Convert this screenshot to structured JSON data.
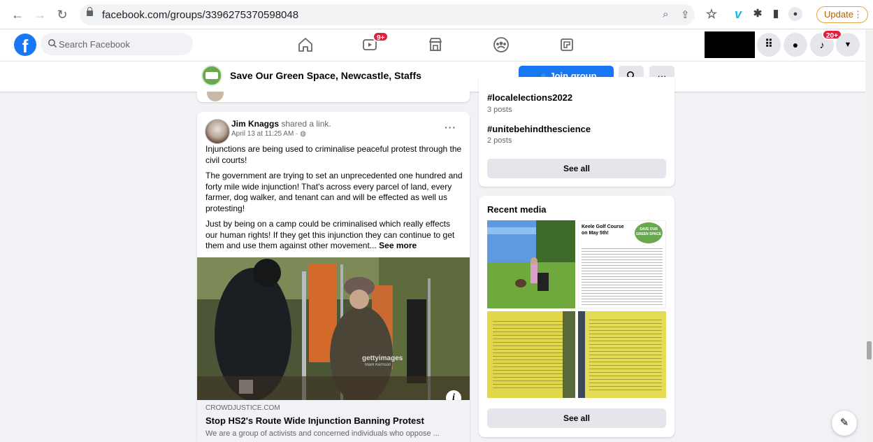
{
  "browser": {
    "url": "facebook.com/groups/3396275370598048",
    "update_label": "Update",
    "update_menu": "⋮"
  },
  "fb": {
    "search_placeholder": "Search Facebook",
    "watch_badge": "9+",
    "notif_badge": "20+"
  },
  "group": {
    "name": "Save Our Green Space, Newcastle, Staffs",
    "join_label": "Join group",
    "more_label": "···"
  },
  "post": {
    "author": "Jim Knaggs",
    "action": "shared a link.",
    "date": "April 13 at 11:25 AM · ",
    "more": "···",
    "paragraphs": [
      "Injunctions are being used to criminalise peaceful protest through the civil courts!",
      "The government are trying to set an unprecedented one hundred and forty mile wide injunction! That's across every parcel of land, every farmer, dog walker, and tenant can and will be effected as well us protesting!",
      "Just by being on a camp could be criminalised which really effects our human rights! If they get this injunction they can continue to get them and use them against other movement..."
    ],
    "see_more": "See more",
    "photo_watermark": "gettyimages",
    "photo_credit": "Mark Kerrison",
    "info_icon": "i",
    "link_domain": "CROWDJUSTICE.COM",
    "link_title": "Stop HS2's Route Wide Injunction Banning Protest",
    "link_desc": "We are a group of activists and concerned individuals who oppose ..."
  },
  "topics": {
    "items": [
      {
        "tag": "#localelections2022",
        "count": "3 posts"
      },
      {
        "tag": "#unitebehindthescience",
        "count": "2 posts"
      }
    ],
    "see_all": "See all"
  },
  "media": {
    "title": "Recent media",
    "flyer_heading": "Keele Golf Course on May 5th!",
    "flyer_badge": "SAVE OUR GREEN SPACE",
    "see_all": "See all"
  },
  "colors": {
    "fb_blue": "#1877f2",
    "badge_red": "#e41e3f",
    "page_bg": "#f0f2f5"
  }
}
